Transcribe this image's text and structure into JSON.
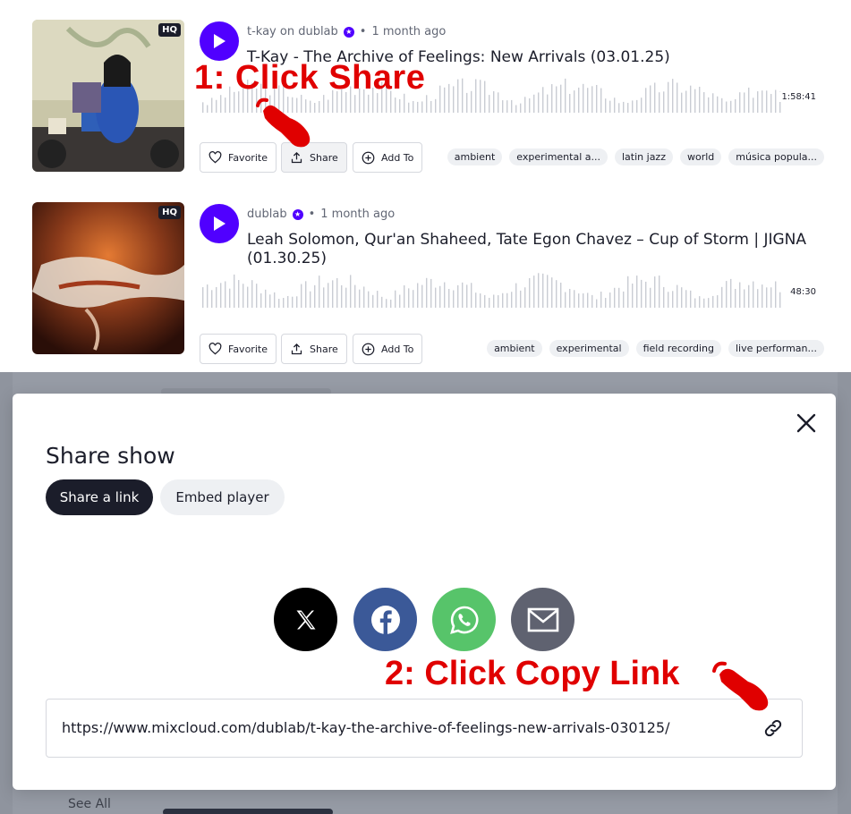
{
  "shows": [
    {
      "uploader": "t-kay on dublab",
      "age": "1 month ago",
      "quality": "HQ",
      "title": "T-Kay - The Archive of Feelings: New Arrivals (03.01.25)",
      "duration": "1:58:41",
      "buttons": {
        "favorite": "Favorite",
        "share": "Share",
        "add_to": "Add To"
      },
      "tags": [
        "ambient",
        "experimental a...",
        "latin jazz",
        "world",
        "música popula..."
      ]
    },
    {
      "uploader": "dublab",
      "age": "1 month ago",
      "quality": "HQ",
      "title": "Leah Solomon, Qur'an Shaheed, Tate Egon Chavez – Cup of Storm | JIGNA (01.30.25)",
      "duration": "48:30",
      "buttons": {
        "favorite": "Favorite",
        "share": "Share",
        "add_to": "Add To"
      },
      "tags": [
        "ambient",
        "experimental",
        "field recording",
        "live performan..."
      ]
    }
  ],
  "annotations": {
    "step1": "1: Click Share",
    "step2": "2: Click Copy Link"
  },
  "background": {
    "see_all": "See All"
  },
  "modal": {
    "title": "Share show",
    "tabs": [
      "Share a link",
      "Embed player"
    ],
    "active_tab": "Share a link",
    "social": [
      {
        "name": "x-icon",
        "color": "#000000"
      },
      {
        "name": "facebook-icon",
        "color": "#3b5998"
      },
      {
        "name": "whatsapp-icon",
        "color": "#57c46a"
      },
      {
        "name": "email-icon",
        "color": "#5f6270"
      }
    ],
    "url": "https://www.mixcloud.com/dublab/t-kay-the-archive-of-feelings-new-arrivals-030125/"
  },
  "colors": {
    "accent": "#5000ff",
    "annotation": "#e00000",
    "dark": "#1b1d2a"
  }
}
